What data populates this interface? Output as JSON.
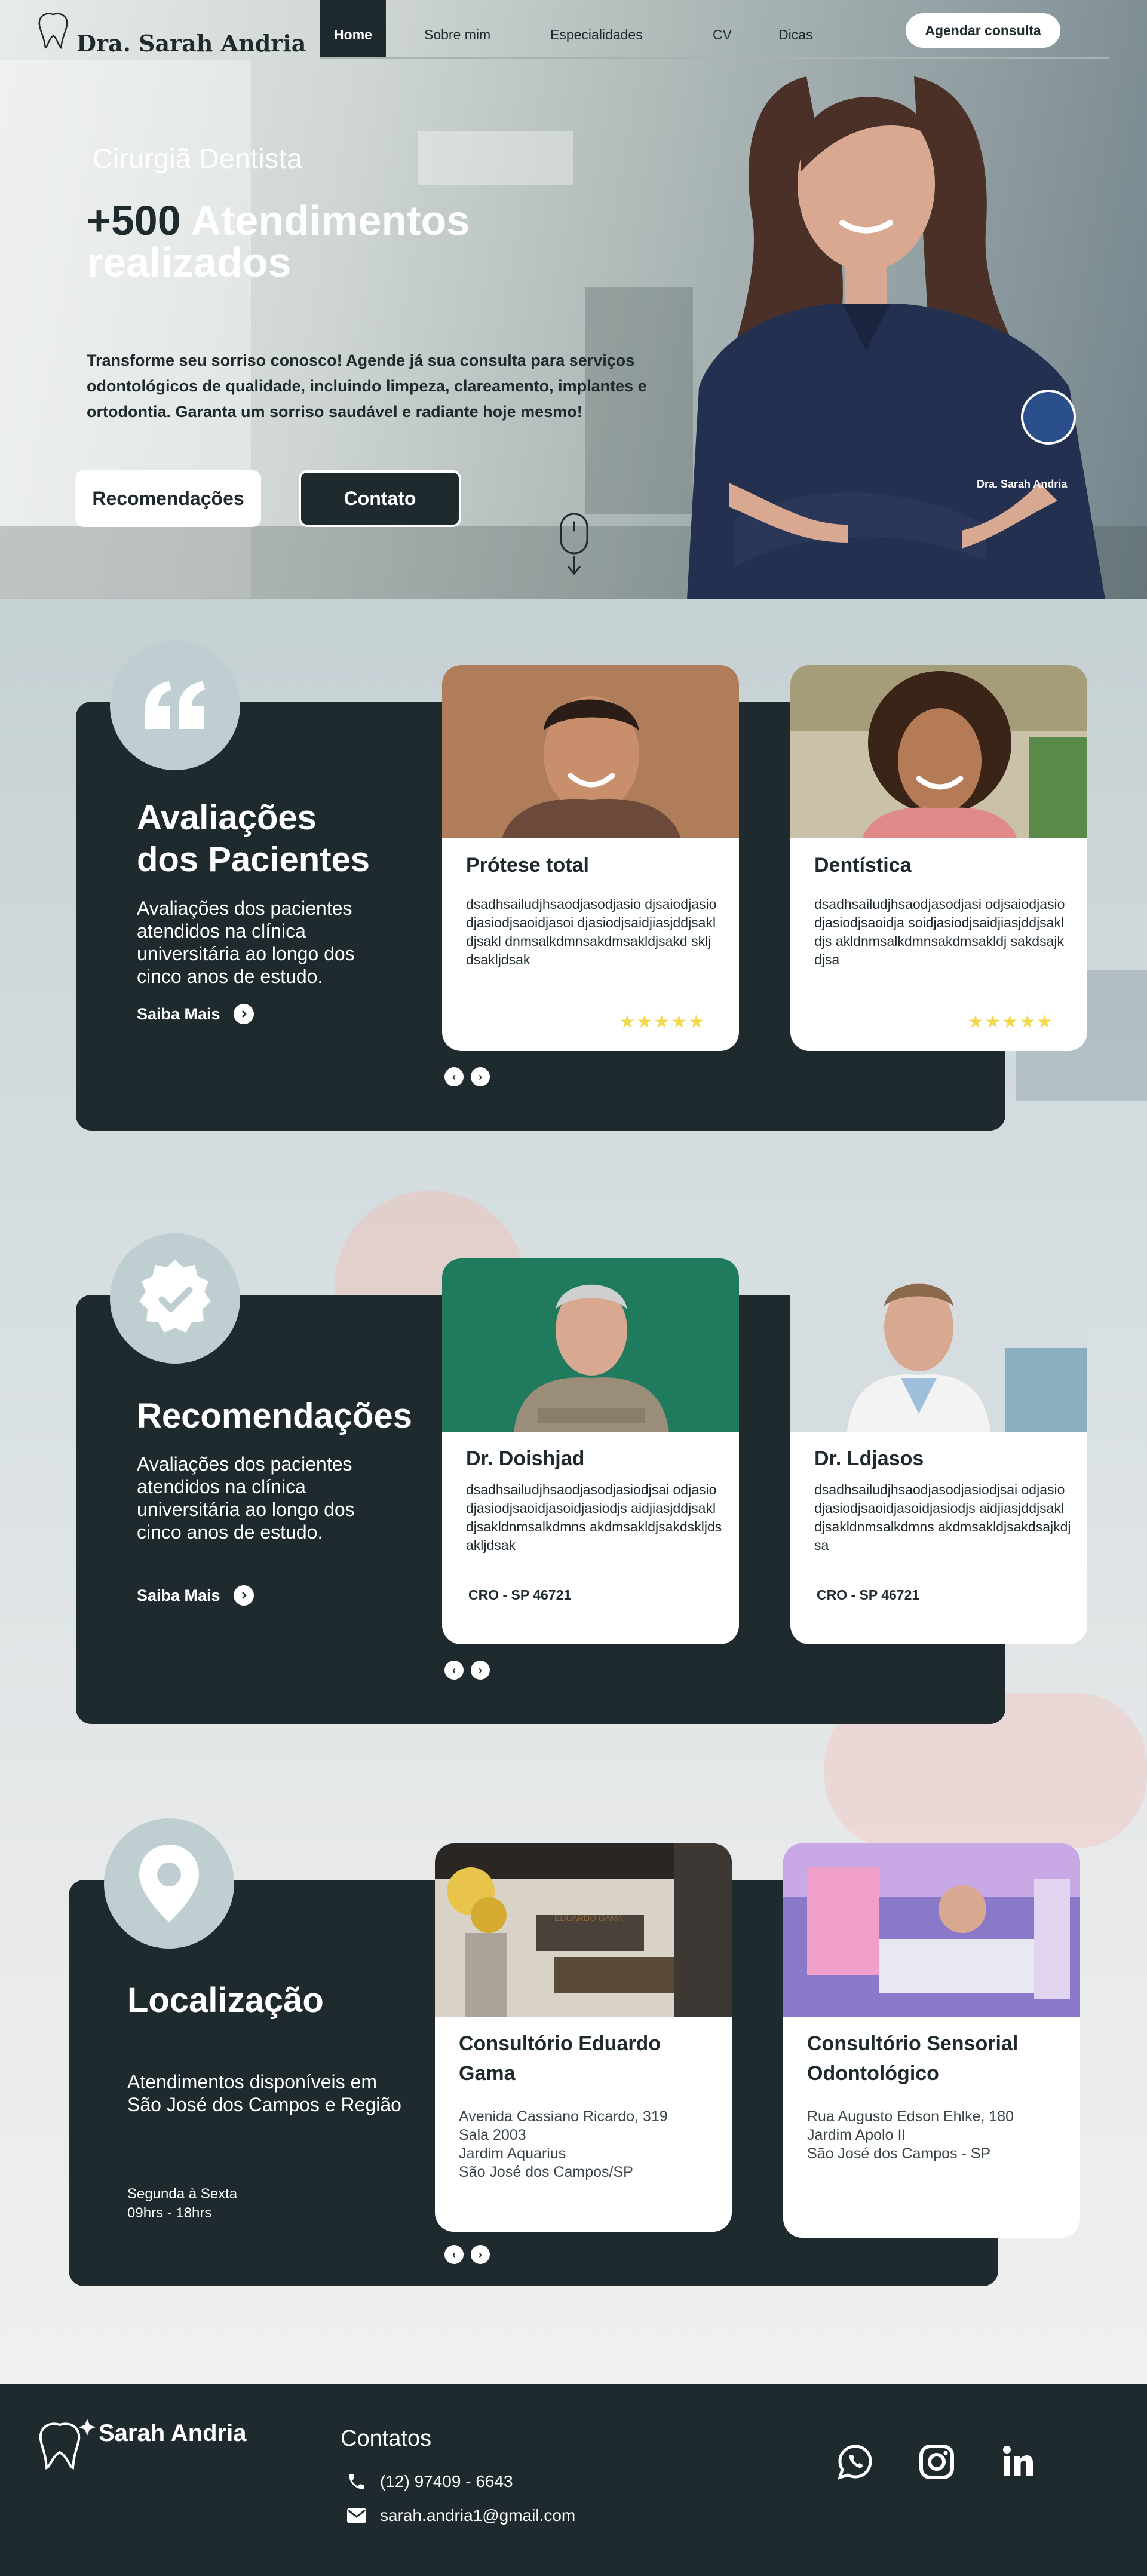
{
  "brand": {
    "name": "Dra. Sarah Andria"
  },
  "nav": {
    "items": [
      "Home",
      "Sobre mim",
      "Especialidades",
      "CV",
      "Dicas"
    ],
    "cta": "Agendar consulta"
  },
  "hero": {
    "subtitle": "Cirurgiã Dentista",
    "title_number": "+500",
    "title_rest": "Atendimentos realizados",
    "description": "Transforme seu sorriso conosco! Agende já sua consulta para serviços odontológicos de qualidade, incluindo limpeza, clareamento, implantes e ortodontia. Garanta um sorriso saudável e radiante hoje mesmo!",
    "btn_primary": "Recomendações",
    "btn_secondary": "Contato",
    "coat_text": "Dra. Sarah Andria"
  },
  "reviews": {
    "title_line1": "Avaliações",
    "title_line2": "dos Pacientes",
    "text": "Avaliações dos pacientes atendidos na clínica universitária ao longo dos cinco anos de estudo.",
    "more": "Saiba Mais",
    "cards": [
      {
        "title": "Prótese total",
        "body": "dsadhsailudjhsaodjasodjasio djsaiodjasiodjasiodjsaoidjasoi djasiodjsaidjiasjddjsakldjsakl dnmsalkdmnsakdmsakldjsakd skljdsakljdsak",
        "stars": "★★★★★",
        "rating": 5
      },
      {
        "title": "Dentística",
        "body": "dsadhsailudjhsaodjasodjasi odjsaiodjasiodjasiodjsaoidja soidjasiodjsaidjiasjddjsakldjs akldnmsalkdmnsakdmsakldj sakdsajkdjsa",
        "stars": "★★★★★",
        "rating": 5
      }
    ]
  },
  "recommendations": {
    "title": "Recomendações",
    "text": "Avaliações dos pacientes atendidos na clínica universitária ao longo dos cinco anos de estudo.",
    "more": "Saiba Mais",
    "cards": [
      {
        "title": "Dr. Doishjad",
        "body": "dsadhsailudjhsaodjasodjasiodjsai odjasiodjasiodjsaoidjasoidjasiodjs aidjiasjddjsakldjsakldnmsalkdmns akdmsakldjsakdskljdsakljdsak",
        "cro": "CRO - SP 46721"
      },
      {
        "title": "Dr. Ldjasos",
        "body": "dsadhsailudjhsaodjasodjasiodjsai odjasiodjasiodjsaoidjasoidjasiodjs aidjiasjddjsakldjsakldnmsalkdmns akdmsakldjsakdsajkdjsa",
        "cro": "CRO - SP 46721"
      }
    ]
  },
  "location": {
    "title": "Localização",
    "text": "Atendimentos disponíveis em São José dos Campos e Região",
    "hours_days": "Segunda à Sexta",
    "hours_time": "09hrs - 18hrs",
    "cards": [
      {
        "title": "Consultório Eduardo Gama",
        "lines": [
          "Avenida Cassiano Ricardo, 319",
          "Sala 2003",
          "Jardim Aquarius",
          "São José dos Campos/SP"
        ],
        "sign": "EDUARDO GAMA"
      },
      {
        "title": "Consultório Sensorial Odontológico",
        "lines": [
          "Rua Augusto Edson Ehlke, 180",
          "Jardim Apolo II",
          "São José dos Campos - SP"
        ]
      }
    ]
  },
  "footer": {
    "name": "Sarah Andria",
    "contacts_title": "Contatos",
    "phone": "(12) 97409 - 6643",
    "email": "sarah.andria1@gmail.com",
    "social": [
      "whatsapp-icon",
      "instagram-icon",
      "linkedin-icon"
    ]
  },
  "colors": {
    "dark": "#1f2a2e",
    "badge": "#bfced1",
    "star": "#f2d94b",
    "white": "#ffffff"
  }
}
